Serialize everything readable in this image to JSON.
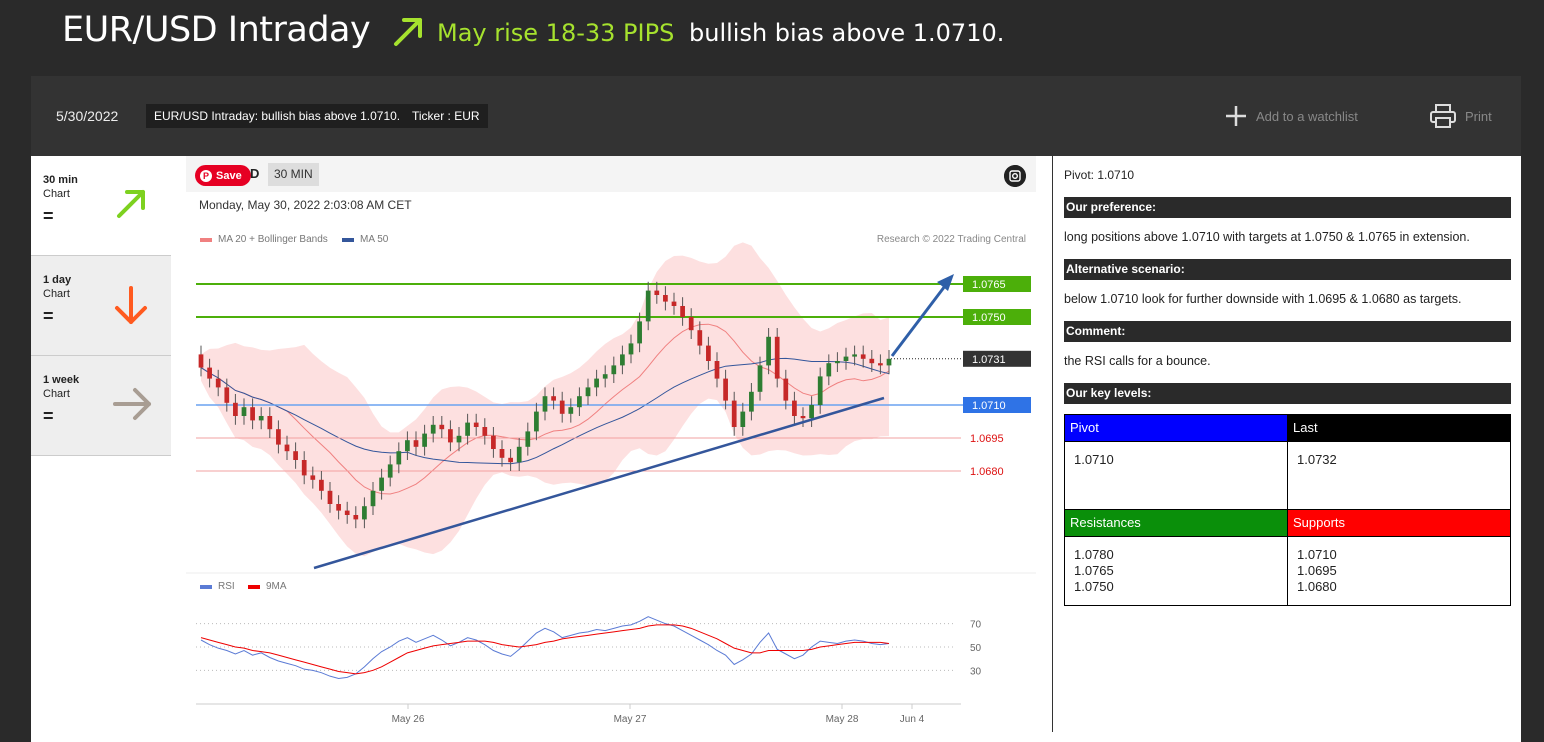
{
  "headline": {
    "title": "EUR/USD Intraday",
    "rise": "May rise 18-33 PIPS",
    "bias": "bullish bias above 1.0710.",
    "arrow_color": "#a6e22e",
    "arrow_icon": "arrow-up-right-icon"
  },
  "toolbar": {
    "date": "5/30/2022",
    "summary_tag": "EUR/USD Intraday: bullish bias above 1.0710.",
    "ticker_tag": "Ticker : EUR",
    "watchlist_label": "Add to a watchlist",
    "print_label": "Print"
  },
  "timeframes": [
    {
      "label": "30 min",
      "sub": "Chart",
      "eq": "=",
      "direction": "up-right",
      "color": "#7dd11f"
    },
    {
      "label": "1 day",
      "sub": "Chart",
      "eq": "=",
      "direction": "down",
      "color": "#ff5a1f"
    },
    {
      "label": "1 week",
      "sub": "Chart",
      "eq": "=",
      "direction": "right",
      "color": "#a89d93"
    }
  ],
  "chart": {
    "save_label": "Save",
    "symbol_suffix": "D",
    "timeframe_button": "30 MIN",
    "timestamp": "Monday, May 30, 2022 2:03:08 AM CET",
    "legend_ma20": "MA 20 + Bollinger Bands",
    "legend_ma50": "MA 50",
    "copyright": "Research © 2022 Trading Central",
    "rsi_legend": "RSI",
    "rsi_ma_legend": "9MA"
  },
  "chart_data": {
    "type": "line",
    "price_levels": [
      {
        "label": "1.0765",
        "style": "green-box",
        "color": "#4caf0a"
      },
      {
        "label": "1.0750",
        "style": "green-box",
        "color": "#4caf0a"
      },
      {
        "label": "1.0731",
        "style": "dark-box",
        "color": "#333333"
      },
      {
        "label": "1.0710",
        "style": "blue-box",
        "color": "#2f73e6"
      },
      {
        "label": "1.0695",
        "style": "red-text",
        "color": "#d11"
      },
      {
        "label": "1.0680",
        "style": "red-text",
        "color": "#d11"
      }
    ],
    "rsi_ticks": [
      "70",
      "50",
      "30"
    ],
    "x_ticks": [
      "May 26",
      "May 27",
      "May 28",
      "Jun 4"
    ],
    "price_close": [
      1.0727,
      1.0722,
      1.0718,
      1.0711,
      1.0705,
      1.0709,
      1.0703,
      1.0705,
      1.0699,
      1.0692,
      1.0689,
      1.0685,
      1.0678,
      1.0676,
      1.0671,
      1.0665,
      1.0662,
      1.066,
      1.0658,
      1.0664,
      1.0671,
      1.0677,
      1.0683,
      1.0689,
      1.0694,
      1.0691,
      1.0697,
      1.0701,
      1.0699,
      1.0693,
      1.0696,
      1.0702,
      1.07,
      1.0696,
      1.069,
      1.0686,
      1.0684,
      1.0691,
      1.0698,
      1.0707,
      1.0714,
      1.0712,
      1.0706,
      1.0709,
      1.0714,
      1.0718,
      1.0722,
      1.0724,
      1.0728,
      1.0733,
      1.0738,
      1.0748,
      1.0762,
      1.076,
      1.0757,
      1.0755,
      1.075,
      1.0744,
      1.0737,
      1.073,
      1.0722,
      1.0712,
      1.07,
      1.0707,
      1.0716,
      1.0728,
      1.0741,
      1.0722,
      1.0712,
      1.0705,
      1.0704,
      1.071,
      1.0723,
      1.0729,
      1.073,
      1.0732,
      1.0733,
      1.0731,
      1.0729,
      1.0728,
      1.0731
    ],
    "rsi": [
      56,
      52,
      49,
      47,
      44,
      47,
      43,
      45,
      41,
      38,
      36,
      34,
      31,
      30,
      28,
      25,
      23,
      24,
      27,
      33,
      40,
      46,
      50,
      55,
      58,
      54,
      57,
      60,
      56,
      51,
      54,
      58,
      56,
      52,
      47,
      44,
      42,
      48,
      55,
      62,
      66,
      63,
      58,
      60,
      62,
      63,
      65,
      64,
      66,
      68,
      69,
      72,
      76,
      73,
      70,
      68,
      64,
      60,
      56,
      52,
      47,
      43,
      35,
      39,
      44,
      54,
      62,
      48,
      44,
      40,
      43,
      50,
      55,
      54,
      53,
      55,
      56,
      55,
      53,
      52,
      53
    ],
    "rsi_ma": [
      58,
      56,
      54,
      52,
      50,
      49,
      47,
      46,
      45,
      43,
      41,
      39,
      37,
      35,
      33,
      31,
      29,
      28,
      27,
      28,
      30,
      33,
      37,
      41,
      45,
      47,
      49,
      51,
      52,
      53,
      54,
      55,
      55,
      55,
      54,
      52,
      51,
      50,
      51,
      52,
      54,
      55,
      57,
      58,
      59,
      60,
      61,
      62,
      63,
      64,
      65,
      66,
      68,
      69,
      69,
      69,
      68,
      66,
      63,
      60,
      57,
      53,
      49,
      47,
      45,
      45,
      47,
      47,
      47,
      47,
      47,
      48,
      50,
      51,
      52,
      53,
      54,
      54,
      54,
      54,
      53
    ]
  },
  "info": {
    "pivot_line": "Pivot: 1.0710",
    "pref_header": "Our preference:",
    "pref_text": "long positions above 1.0710 with targets at 1.0750 & 1.0765 in extension.",
    "alt_header": "Alternative scenario:",
    "alt_text": "below 1.0710 look for further downside with 1.0695 & 1.0680 as targets.",
    "comment_header": "Comment:",
    "comment_text": "the RSI calls for a bounce.",
    "levels_header": "Our key levels:",
    "table": {
      "pivot_h": "Pivot",
      "last_h": "Last",
      "pivot_v": "1.0710",
      "last_v": "1.0732",
      "res_h": "Resistances",
      "sup_h": "Supports",
      "res": [
        "1.0780",
        "1.0765",
        "1.0750"
      ],
      "sup": [
        "1.0710",
        "1.0695",
        "1.0680"
      ]
    },
    "colors": {
      "pivot": "#0000ff",
      "last": "#000000",
      "res": "#0a8f0a",
      "sup": "#ff0000"
    }
  }
}
